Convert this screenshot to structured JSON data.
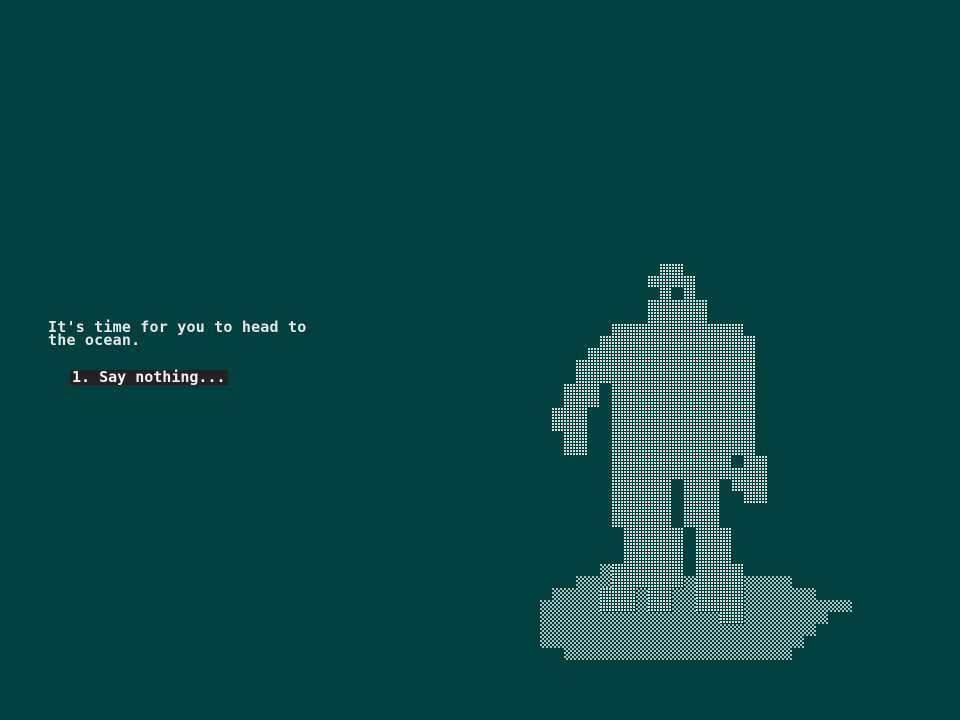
{
  "narration": {
    "line1": "It's time for you to head to",
    "line2": "the ocean."
  },
  "choices": [
    {
      "label": "1. Say nothing..."
    }
  ],
  "colors": {
    "background": "#024040",
    "text": "#e6e6e6",
    "choice_highlight": "#222222",
    "figure": "#cfd6d4",
    "ground": "#9fb6b2"
  }
}
